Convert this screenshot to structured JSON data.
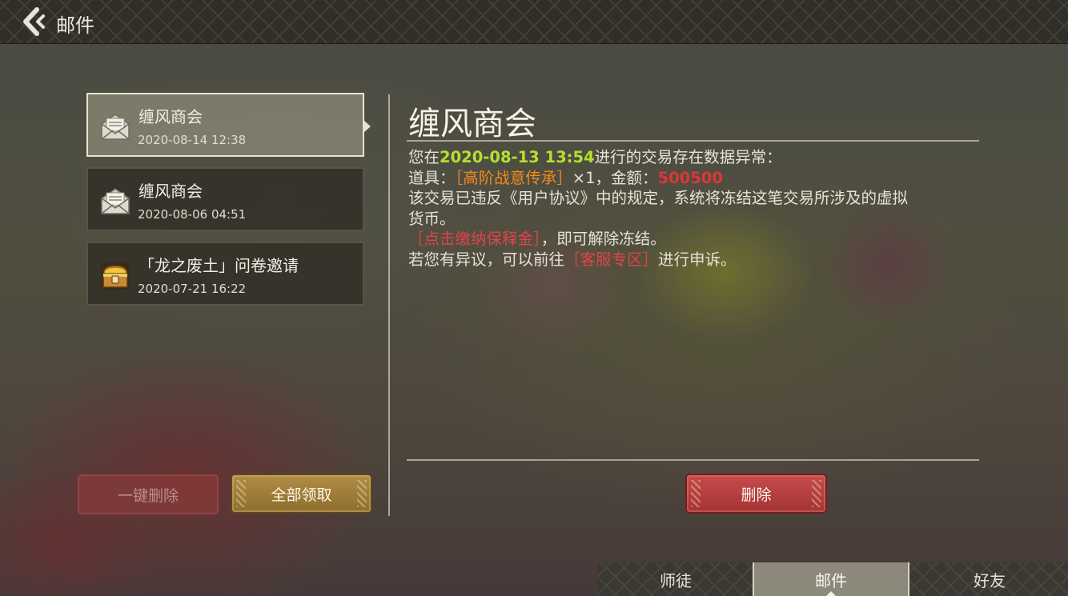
{
  "header": {
    "title": "邮件"
  },
  "mail_list": [
    {
      "sender": "缠风商会",
      "date": "2020-08-14  12:38",
      "icon": "envelope-open-icon",
      "selected": true
    },
    {
      "sender": "缠风商会",
      "date": "2020-08-06  04:51",
      "icon": "envelope-open-icon",
      "selected": false
    },
    {
      "sender": "「龙之废土」问卷邀请",
      "date": "2020-07-21  16:22",
      "icon": "treasure-chest-icon",
      "selected": false
    }
  ],
  "buttons": {
    "delete_all": "一键删除",
    "claim_all": "全部领取",
    "delete": "删除"
  },
  "detail": {
    "title": "缠风商会",
    "line1_prefix": "您在",
    "line1_date": "2020-08-13  13:54",
    "line1_suffix": "进行的交易存在数据异常：",
    "line2_prefix": "道具：",
    "line2_item": "［高阶战意传承］",
    "line2_qty": "×1，金额：",
    "line2_amount": "500500",
    "line3": "该交易已违反《用户协议》中的规定，系统将冻结这笔交易所涉及的虚拟",
    "line4": "货币。",
    "line5_link": "［点击缴纳保释金］",
    "line5_suffix": "，即可解除冻结。",
    "line6_prefix": "若您有异议，可以前往",
    "line6_link": "［客服专区］",
    "line6_suffix": "进行申诉。"
  },
  "tabs": [
    {
      "label": "师徒",
      "active": false
    },
    {
      "label": "邮件",
      "active": true
    },
    {
      "label": "好友",
      "active": false
    }
  ],
  "colors": {
    "highlight_green": "#b7e02e",
    "item_orange": "#f08a22",
    "amount_red": "#e0343a",
    "claim_gold": "#a07f3a",
    "delete_red": "#b84040"
  }
}
